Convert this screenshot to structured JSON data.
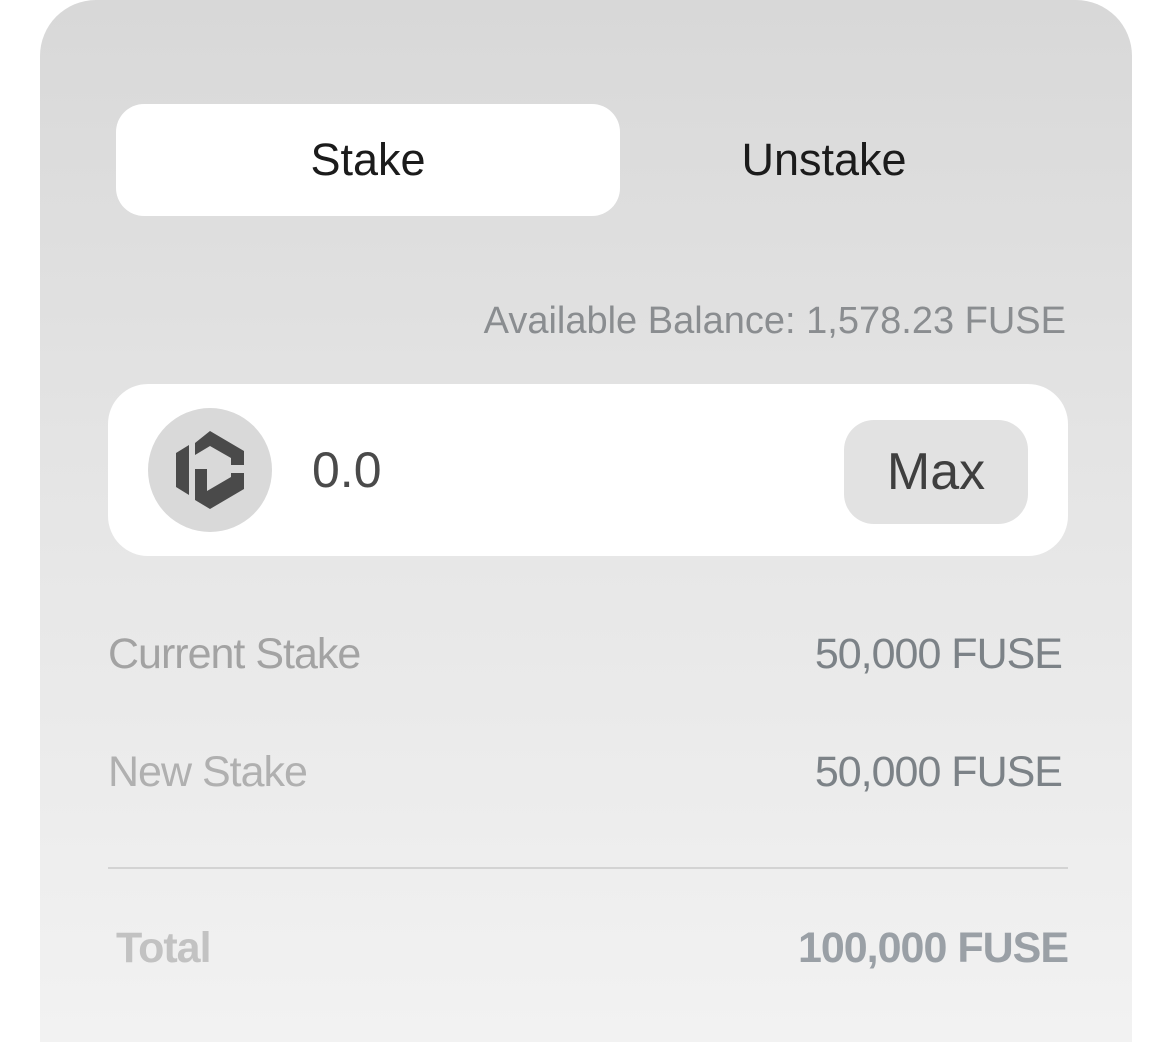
{
  "tabs": {
    "stake_label": "Stake",
    "unstake_label": "Unstake",
    "active": "Stake"
  },
  "balance": {
    "text": "Available Balance: 1,578.23 FUSE"
  },
  "amount_input": {
    "value": "",
    "placeholder": "0.0",
    "token_icon": "fuse-token-icon",
    "max_label": "Max"
  },
  "summary": {
    "current_stake_label": "Current Stake",
    "current_stake_value": "50,000 FUSE",
    "new_stake_label": "New Stake",
    "new_stake_value": "50,000 FUSE",
    "total_label": "Total",
    "total_value": "100,000 FUSE"
  },
  "colors": {
    "card_top": "#d8d8d8",
    "card_bottom": "#f2f2f2",
    "active_tab_bg": "#ffffff",
    "muted_text": "#8a8d90",
    "value_text": "#7c8287"
  }
}
